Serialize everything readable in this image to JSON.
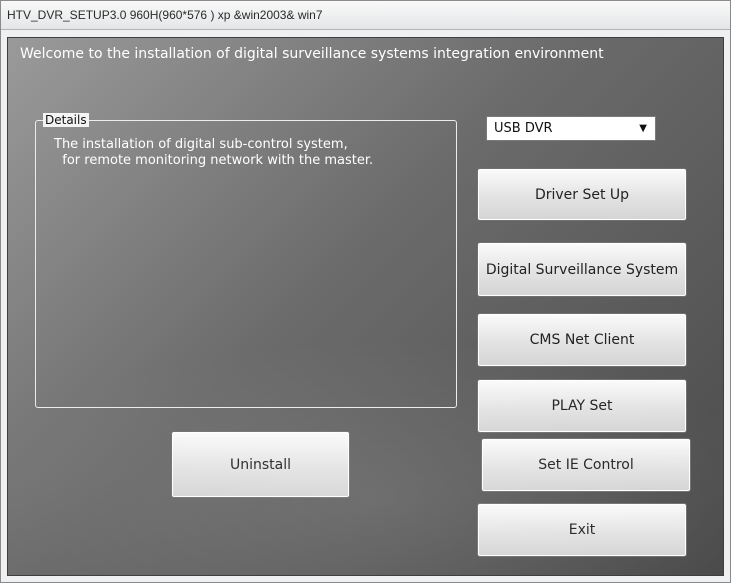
{
  "window": {
    "title": "HTV_DVR_SETUP3.0   960H(960*576 )  xp &win2003& win7"
  },
  "main": {
    "welcome": "Welcome to the installation of digital surveillance systems integration environment",
    "details": {
      "legend": "Details",
      "text": "The installation of digital sub-control system,\n  for remote monitoring network with the master."
    },
    "dvr_type": {
      "selected": "USB DVR",
      "arrow_icon": "dropdown-arrow-icon"
    },
    "buttons": {
      "driver_setup": "Driver Set Up",
      "digital_surveillance": "Digital Surveillance System",
      "cms_net_client": "CMS Net Client",
      "play_set": "PLAY Set",
      "set_ie_control": "Set IE Control",
      "exit": "Exit",
      "uninstall": "Uninstall"
    }
  }
}
